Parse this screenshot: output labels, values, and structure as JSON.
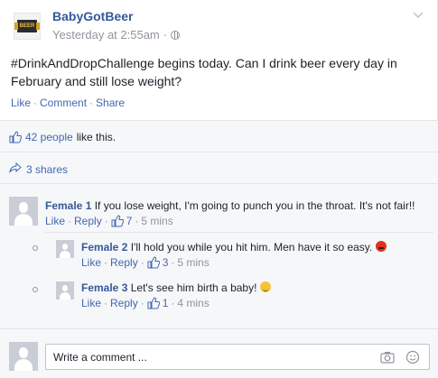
{
  "post": {
    "page_name": "BabyGotBeer",
    "timestamp": "Yesterday at 2:55am",
    "separator": "·",
    "text": "#DrinkAndDropChallenge begins today. Can I drink beer every day in February and still lose weight?",
    "actions": {
      "like": "Like",
      "comment": "Comment",
      "share": "Share",
      "dot": "·"
    },
    "likes": {
      "count_link": "42 people",
      "suffix": "like this."
    },
    "shares": "3 shares",
    "logo_text": "BEER"
  },
  "comments": [
    {
      "author": "Female 1",
      "text": "If you lose weight, I'm going to punch you in the throat. It's not fair!!",
      "like": "Like",
      "reply": "Reply",
      "likes": "7",
      "time": "5 mins"
    }
  ],
  "replies": [
    {
      "author": "Female 2",
      "text": "I'll hold you while you hit him. Men have it so easy.",
      "emoji": "angry-face",
      "like": "Like",
      "reply": "Reply",
      "likes": "3",
      "time": "5 mins"
    },
    {
      "author": "Female 3",
      "text": "Let's see him birth a baby!",
      "emoji": "winking-tongue-face",
      "like": "Like",
      "reply": "Reply",
      "likes": "1",
      "time": "4 mins"
    }
  ],
  "composer": {
    "placeholder": "Write a comment ..."
  },
  "colors": {
    "link": "#4267b2",
    "name": "#365899",
    "meta": "#90949c",
    "section_bg": "#f6f7f9"
  }
}
